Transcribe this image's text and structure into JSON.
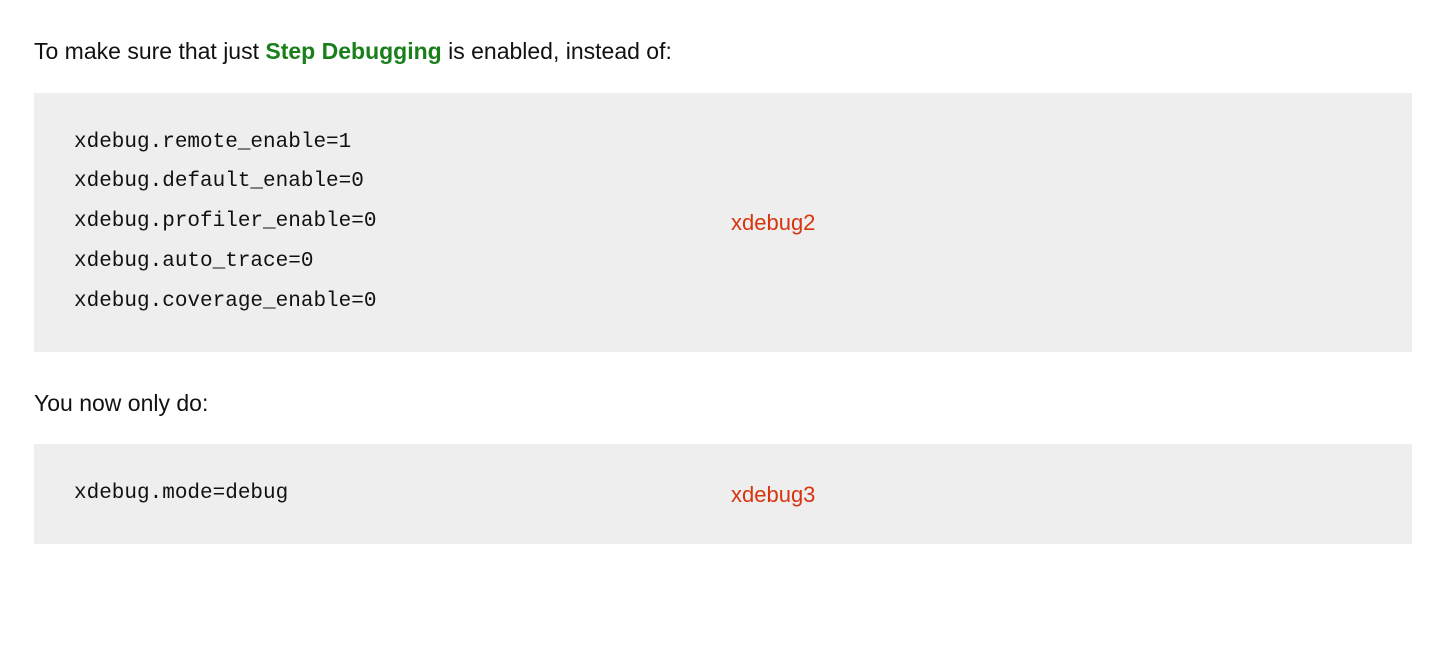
{
  "intro": {
    "before_link": "To make sure that just ",
    "link_text": "Step Debugging",
    "after_link": " is enabled, instead of:"
  },
  "block1": {
    "code": "xdebug.remote_enable=1\nxdebug.default_enable=0\nxdebug.profiler_enable=0\nxdebug.auto_trace=0\nxdebug.coverage_enable=0",
    "label": "xdebug2"
  },
  "middle_text": "You now only do:",
  "block2": {
    "code": "xdebug.mode=debug",
    "label": "xdebug3"
  }
}
